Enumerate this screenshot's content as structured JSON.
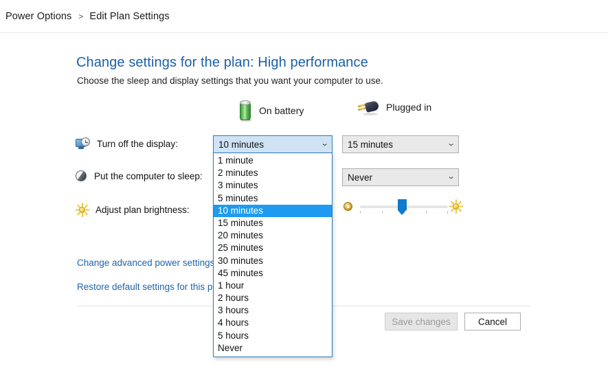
{
  "breadcrumb": {
    "root": "Power Options",
    "separator": ">",
    "current": "Edit Plan Settings"
  },
  "page": {
    "title": "Change settings for the plan: High performance",
    "subtitle": "Choose the sleep and display settings that you want your computer to use."
  },
  "columns": {
    "battery": {
      "label": "On battery",
      "icon": "battery-icon"
    },
    "plugged": {
      "label": "Plugged in",
      "icon": "power-plug-icon"
    }
  },
  "rows": [
    {
      "label": "Turn off the display:",
      "icon": "display-clock-icon"
    },
    {
      "label": "Put the computer to sleep:",
      "icon": "sleep-moon-icon"
    },
    {
      "label": "Adjust plan brightness:",
      "icon": "brightness-sun-icon"
    }
  ],
  "controls": {
    "display_battery": {
      "value": "10 minutes",
      "expanded": true
    },
    "display_plugged": {
      "value": "15 minutes",
      "expanded": false
    },
    "sleep_plugged": {
      "value": "Never",
      "expanded": false
    },
    "brightness_plugged": {
      "value_percent": 48,
      "dim_icon": "low-brightness-icon",
      "bright_icon": "high-brightness-icon"
    }
  },
  "dropdown": {
    "selected": "10 minutes",
    "options": [
      "1 minute",
      "2 minutes",
      "3 minutes",
      "5 minutes",
      "10 minutes",
      "15 minutes",
      "20 minutes",
      "25 minutes",
      "30 minutes",
      "45 minutes",
      "1 hour",
      "2 hours",
      "3 hours",
      "4 hours",
      "5 hours",
      "Never"
    ]
  },
  "links": {
    "advanced": "Change advanced power settings",
    "restore": "Restore default settings for this plan"
  },
  "buttons": {
    "save": {
      "label": "Save changes",
      "enabled": false
    },
    "cancel": {
      "label": "Cancel",
      "enabled": true
    }
  },
  "colors": {
    "title_blue": "#1a5fa8",
    "link_blue": "#1a64ae",
    "highlight_blue": "#1e9bf0",
    "combo_border_focus": "#2a7ab9",
    "slider_thumb": "#0f79d0",
    "battery_green": "#6cc463"
  },
  "icons": {
    "chevron_down": "⌄"
  }
}
